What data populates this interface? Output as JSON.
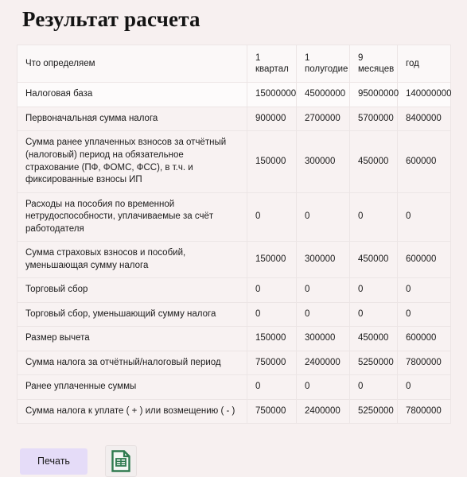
{
  "page": {
    "title": "Результат расчета",
    "background_color": "#f7f0f0"
  },
  "table": {
    "headers": {
      "name": "Что определяем",
      "columns": [
        {
          "line1": "1",
          "line2": "квартал"
        },
        {
          "line1": "1",
          "line2": "полугодие"
        },
        {
          "line1": "9",
          "line2": "месяцев"
        },
        {
          "line1": "год",
          "line2": ""
        }
      ]
    },
    "rows": [
      {
        "name": "Налоговая база",
        "highlight": true,
        "values": [
          "15000000",
          "45000000",
          "95000000",
          "140000000"
        ]
      },
      {
        "name": "Первоначальная сумма налога",
        "highlight": false,
        "values": [
          "900000",
          "2700000",
          "5700000",
          "8400000"
        ]
      },
      {
        "name": "Сумма ранее уплаченных взносов за отчётный (налоговый) период на обязательное страхование (ПФ, ФОМС, ФСС), в т.ч. и фиксированные взносы ИП",
        "highlight": false,
        "values": [
          "150000",
          "300000",
          "450000",
          "600000"
        ]
      },
      {
        "name": "Расходы на пособия по временной нетрудоспособности, уплачиваемые за счёт работодателя",
        "highlight": false,
        "values": [
          "0",
          "0",
          "0",
          "0"
        ]
      },
      {
        "name": "Сумма страховых взносов и пособий, уменьшающая сумму налога",
        "highlight": false,
        "values": [
          "150000",
          "300000",
          "450000",
          "600000"
        ]
      },
      {
        "name": "Торговый сбор",
        "highlight": false,
        "values": [
          "0",
          "0",
          "0",
          "0"
        ]
      },
      {
        "name": "Торговый сбор, уменьшающий сумму налога",
        "highlight": false,
        "values": [
          "0",
          "0",
          "0",
          "0"
        ]
      },
      {
        "name": "Размер вычета",
        "highlight": false,
        "values": [
          "150000",
          "300000",
          "450000",
          "600000"
        ]
      },
      {
        "name": "Сумма налога за отчётный/налоговый период",
        "highlight": false,
        "values": [
          "750000",
          "2400000",
          "5250000",
          "7800000"
        ]
      },
      {
        "name": "Ранее уплаченные суммы",
        "highlight": false,
        "values": [
          "0",
          "0",
          "0",
          "0"
        ]
      },
      {
        "name": "Сумма налога к уплате ( + ) или возмещению ( - )",
        "highlight": false,
        "values": [
          "750000",
          "2400000",
          "5250000",
          "7800000"
        ]
      }
    ]
  },
  "actions": {
    "print_label": "Печать",
    "print_color": "#e5dcf8",
    "export_icon": "spreadsheet-document-icon",
    "export_icon_color": "#2f7a4f"
  }
}
